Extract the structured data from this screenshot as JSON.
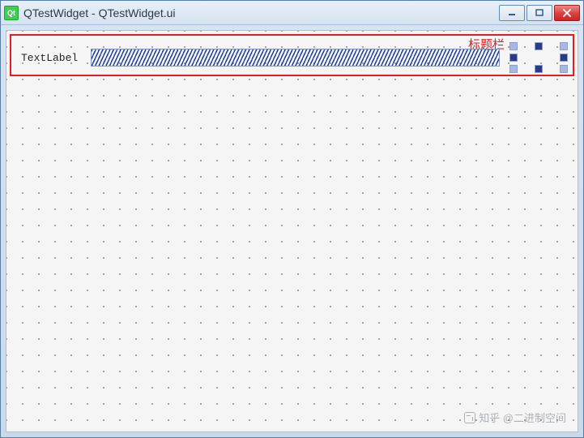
{
  "window": {
    "title": "QTestWidget - QTestWidget.ui",
    "logo_text": "Qt"
  },
  "designer": {
    "text_label": "TextLabel"
  },
  "annotation": {
    "label": "标题栏"
  },
  "watermark": {
    "text": "知乎 @二进制空间"
  },
  "colors": {
    "annotation": "#e02020",
    "hatch": "#2040a0",
    "qt_green": "#41cd52"
  }
}
